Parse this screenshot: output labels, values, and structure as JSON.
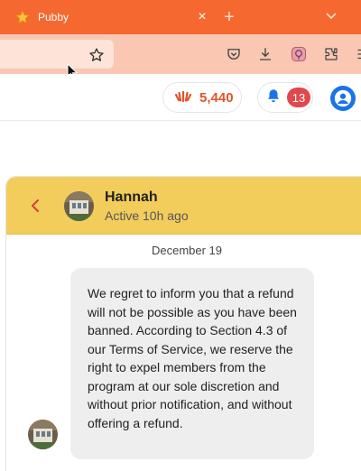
{
  "browser": {
    "tab_title": "Pubby",
    "close_glyph": "×",
    "new_tab_glyph": "+",
    "accent_color": "#f5682f"
  },
  "header": {
    "points": "5,440",
    "notifications_count": "13"
  },
  "chat": {
    "contact_name": "Hannah",
    "contact_status": "Active 10h ago",
    "date_separator": "December 19",
    "header_color": "#f2cd5c",
    "message": "We regret to inform you that a refund will not be possible as you have been banned. According to Section 4.3 of our Terms of Service, we reserve the right to expel members from the program at our sole discretion and without prior notification, and without offering a refund."
  },
  "icons": [
    "star-favicon",
    "tab-close-icon",
    "new-tab-icon",
    "tab-list-chevron-icon",
    "bookmark-star-icon",
    "pocket-icon",
    "download-icon",
    "extension-icon",
    "puzzle-icon",
    "menu-icon",
    "points-icon",
    "bell-icon",
    "user-avatar-icon",
    "back-chevron-icon"
  ]
}
